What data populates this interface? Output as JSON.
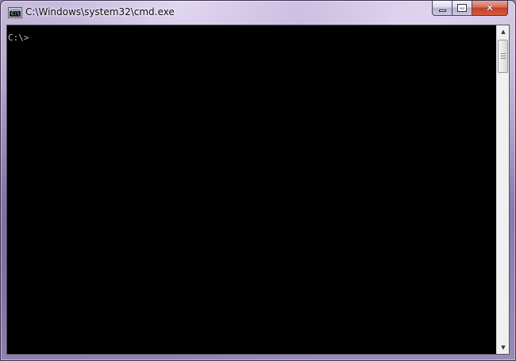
{
  "window": {
    "title": "C:\\Windows\\system32\\cmd.exe",
    "icon": "console-icon",
    "icon_glyph": "C:\\",
    "buttons": {
      "minimize_icon": "minimize-icon",
      "maximize_icon": "maximize-icon",
      "close_icon": "close-icon",
      "close_glyph": "✕"
    }
  },
  "console": {
    "lines": [
      "C:\\>"
    ],
    "text_color": "#c0c0c0",
    "background": "#000000"
  },
  "scrollbar": {
    "up_arrow": "▲",
    "down_arrow": "▼"
  }
}
